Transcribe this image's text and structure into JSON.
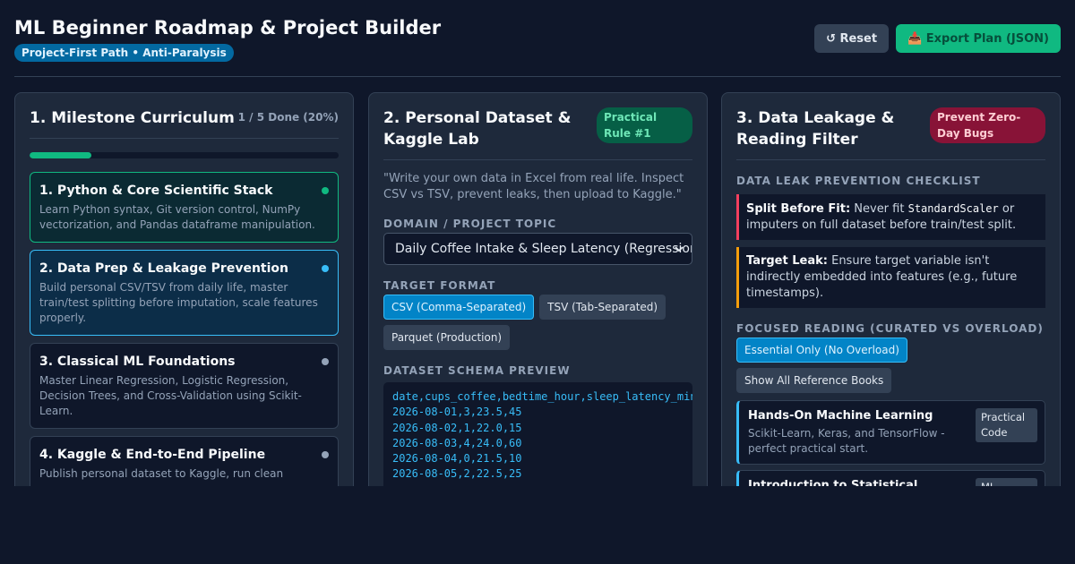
{
  "header": {
    "title": "ML Beginner Roadmap & Project Builder",
    "subtitle": "Project-First Path • Anti-Paralysis",
    "reset_label": "↺ Reset",
    "export_label": "📥 Export Plan (JSON)"
  },
  "curriculum": {
    "title": "1. Milestone Curriculum",
    "progress_text": "1 / 5 Done (20%)",
    "progress_fraction": 0.2,
    "milestones": [
      {
        "title": "1. Python & Core Scientific Stack",
        "desc": "Learn Python syntax, Git version control, NumPy vectorization, and Pandas dataframe manipulation.",
        "status": "done"
      },
      {
        "title": "2. Data Prep & Leakage Prevention",
        "desc": "Build personal CSV/TSV from daily life, master train/test splitting before imputation, scale features properly.",
        "status": "active"
      },
      {
        "title": "3. Classical ML Foundations",
        "desc": "Master Linear Regression, Logistic Regression, Decision Trees, and Cross-Validation using Scikit-Learn.",
        "status": "todo"
      },
      {
        "title": "4. Kaggle & End-to-End Pipeline",
        "desc": "Publish personal dataset to Kaggle, run clean",
        "status": "todo"
      }
    ]
  },
  "dataset": {
    "title": "2. Personal Dataset & Kaggle Lab",
    "badge": "Practical Rule #1",
    "quote": "\"Write your own data in Excel from real life. Inspect CSV vs TSV, prevent leaks, then upload to Kaggle.\"",
    "domain_label": "DOMAIN / PROJECT TOPIC",
    "domain_value": "Daily Coffee Intake & Sleep Latency (Regression)",
    "format_label": "TARGET FORMAT",
    "formats": [
      "CSV (Comma-Separated)",
      "TSV (Tab-Separated)",
      "Parquet (Production)"
    ],
    "selected_format": "CSV (Comma-Separated)",
    "schema_label": "DATASET SCHEMA PREVIEW",
    "schema_lines": [
      "date,cups_coffee,bedtime_hour,sleep_latency_minutes",
      "2026-08-01,3,23.5,45",
      "2026-08-02,1,22.0,15",
      "2026-08-03,4,24.0,60",
      "2026-08-04,0,21.5,10",
      "2026-08-05,2,22.5,25"
    ]
  },
  "leakage": {
    "title": "3. Data Leakage & Reading Filter",
    "badge": "Prevent Zero-Day Bugs",
    "checklist_label": "DATA LEAK PREVENTION CHECKLIST",
    "items": [
      {
        "lead": "Split Before Fit:",
        "pre": " Never fit ",
        "code": "StandardScaler",
        "post": " or imputers on full dataset before train/test split."
      },
      {
        "lead": "Target Leak:",
        "pre": " Ensure target variable isn't indirectly embedded into features (e.g., future timestamps).",
        "code": "",
        "post": ""
      }
    ],
    "reading_label": "FOCUSED READING (CURATED VS OVERLOAD)",
    "reading_options": [
      "Essential Only (No Overload)",
      "Show All Reference Books"
    ],
    "selected_reading": "Essential Only (No Overload)",
    "books": [
      {
        "title": "Hands-On Machine Learning",
        "desc": "Scikit-Learn, Keras, and TensorFlow - perfect practical start.",
        "tag": "Practical Code"
      },
      {
        "title": "Introduction to Statistical Learning",
        "desc": "",
        "tag": "ML Theory"
      }
    ]
  },
  "colors": {
    "accent": "#10b981",
    "info": "#38bdf8",
    "danger": "#f43f5e",
    "warning": "#f59e0b"
  }
}
